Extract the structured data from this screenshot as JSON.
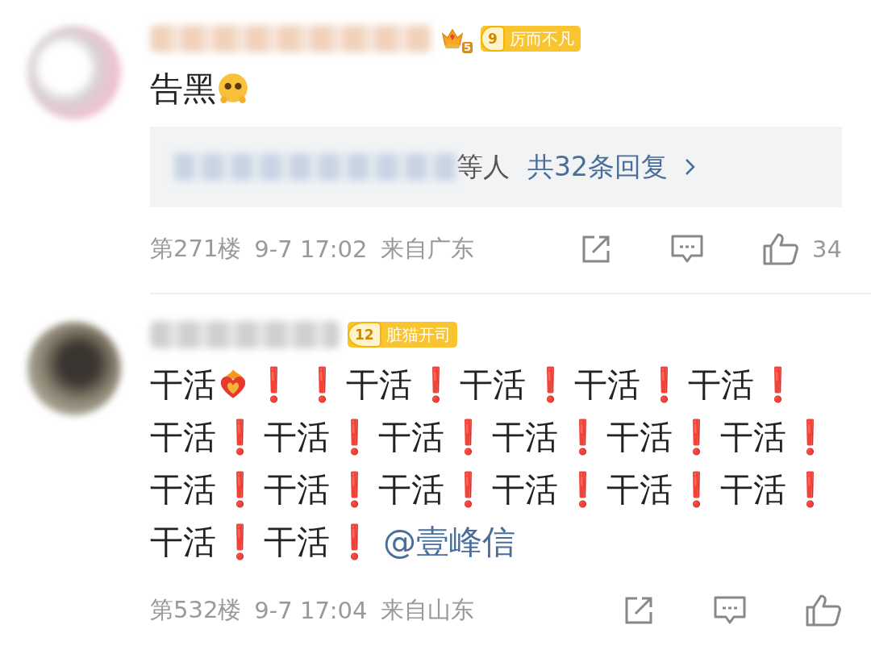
{
  "comments": [
    {
      "badges": [
        {
          "kind": "crown",
          "text": "5"
        },
        {
          "kind": "fan",
          "level_text": "9",
          "label": "厉而不凡"
        }
      ],
      "content": [
        {
          "kind": "text",
          "text": "告黑"
        },
        {
          "kind": "emoji-face"
        }
      ],
      "replies": {
        "suffix": "等人",
        "link": "共32条回复"
      },
      "floor": "第271楼",
      "time": "9-7 17:02",
      "location": "来自广东",
      "likes": "34"
    },
    {
      "badges": [
        {
          "kind": "fan",
          "level_text": "12",
          "label": "脏猫开司"
        }
      ],
      "content": [
        {
          "kind": "text",
          "text": "干活"
        },
        {
          "kind": "emoji-heart"
        },
        {
          "kind": "exclaim",
          "text": "❗"
        },
        {
          "kind": "exclaim",
          "text": "❗"
        },
        {
          "kind": "text",
          "text": "干活"
        },
        {
          "kind": "exclaim",
          "text": "❗"
        },
        {
          "kind": "text",
          "text": "干活"
        },
        {
          "kind": "exclaim",
          "text": "❗"
        },
        {
          "kind": "text",
          "text": "干活"
        },
        {
          "kind": "exclaim",
          "text": "❗"
        },
        {
          "kind": "text",
          "text": "干活"
        },
        {
          "kind": "exclaim",
          "text": "❗"
        },
        {
          "kind": "text",
          "text": "干活"
        },
        {
          "kind": "exclaim",
          "text": "❗"
        },
        {
          "kind": "text",
          "text": "干活"
        },
        {
          "kind": "exclaim",
          "text": "❗"
        },
        {
          "kind": "text",
          "text": "干活"
        },
        {
          "kind": "exclaim",
          "text": "❗"
        },
        {
          "kind": "text",
          "text": "干活"
        },
        {
          "kind": "exclaim",
          "text": "❗"
        },
        {
          "kind": "text",
          "text": "干活"
        },
        {
          "kind": "exclaim",
          "text": "❗"
        },
        {
          "kind": "text",
          "text": "干活"
        },
        {
          "kind": "exclaim",
          "text": "❗"
        },
        {
          "kind": "text",
          "text": "干活"
        },
        {
          "kind": "exclaim",
          "text": "❗"
        },
        {
          "kind": "text",
          "text": "干活"
        },
        {
          "kind": "exclaim",
          "text": "❗"
        },
        {
          "kind": "text",
          "text": "干活"
        },
        {
          "kind": "exclaim",
          "text": "❗"
        },
        {
          "kind": "text",
          "text": "干活"
        },
        {
          "kind": "exclaim",
          "text": "❗"
        },
        {
          "kind": "text",
          "text": "干活"
        },
        {
          "kind": "exclaim",
          "text": "❗"
        },
        {
          "kind": "text",
          "text": "干活"
        },
        {
          "kind": "exclaim",
          "text": "❗"
        },
        {
          "kind": "text",
          "text": "干活"
        },
        {
          "kind": "exclaim",
          "text": "❗"
        },
        {
          "kind": "text",
          "text": "干活"
        },
        {
          "kind": "exclaim",
          "text": "❗"
        },
        {
          "kind": "mention",
          "text": "@壹峰信"
        }
      ],
      "floor": "第532楼",
      "time": "9-7 17:04",
      "location": "来自山东"
    }
  ]
}
